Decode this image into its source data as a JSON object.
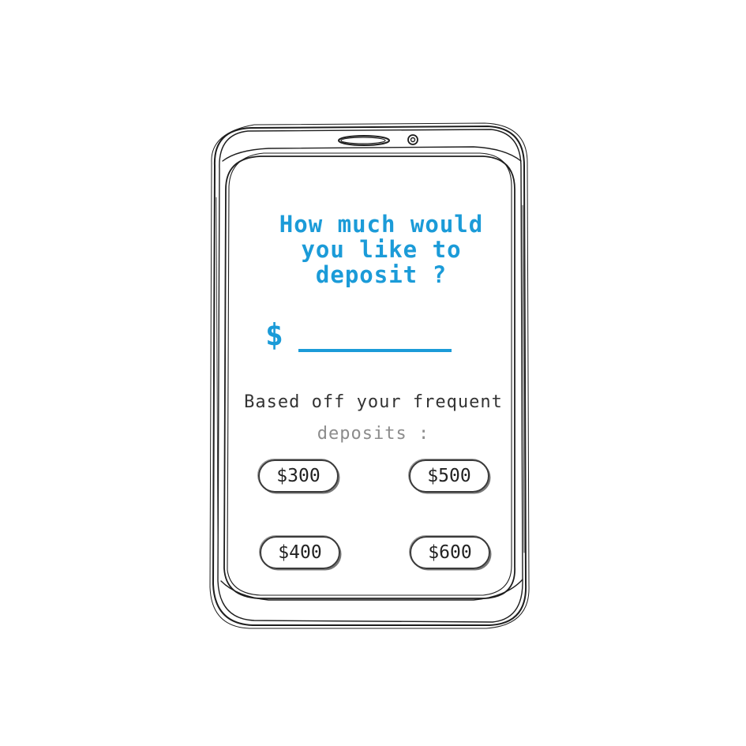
{
  "screen": {
    "question": "How much would you like to deposit ?",
    "currency_symbol": "$",
    "amount_value": ""
  },
  "suggestions": {
    "hint_line1": "Based off your frequent",
    "hint_line2": "deposits :",
    "options": [
      "$300",
      "$500",
      "$400",
      "$600"
    ]
  },
  "colors": {
    "accent": "#1b9bd8",
    "sketch": "#222222",
    "muted": "#8c8c8c"
  }
}
